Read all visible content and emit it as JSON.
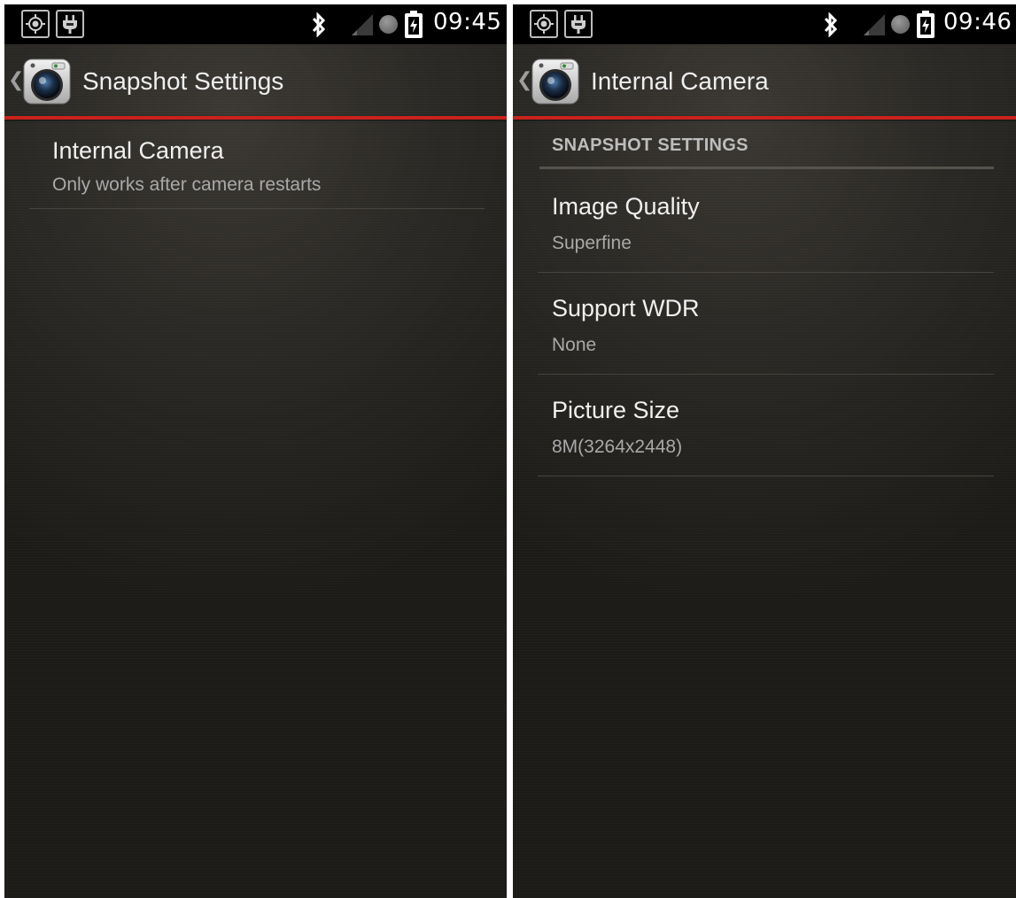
{
  "left_screen": {
    "status_bar": {
      "time": "09:45",
      "icons": [
        "gps-icon",
        "usb-debug-icon",
        "bluetooth-icon",
        "signal-icon",
        "sync-dot-icon",
        "battery-charging-icon"
      ]
    },
    "action_bar": {
      "title": "Snapshot Settings",
      "icon": "camera-app-icon",
      "back": "chevron-left-icon"
    },
    "preferences": [
      {
        "title": "Internal Camera",
        "summary": "Only works after camera restarts"
      }
    ]
  },
  "right_screen": {
    "status_bar": {
      "time": "09:46",
      "icons": [
        "gps-icon",
        "usb-debug-icon",
        "bluetooth-icon",
        "signal-icon",
        "sync-dot-icon",
        "battery-charging-icon"
      ]
    },
    "action_bar": {
      "title": "Internal Camera",
      "icon": "camera-app-icon",
      "back": "chevron-left-icon"
    },
    "category": "SNAPSHOT SETTINGS",
    "preferences": [
      {
        "title": "Image Quality",
        "summary": "Superfine"
      },
      {
        "title": "Support WDR",
        "summary": "None"
      },
      {
        "title": "Picture Size",
        "summary": "8M(3264x2448)"
      }
    ]
  },
  "colors": {
    "accent_underline": "#c8231d",
    "status_bar_bg": "#000000",
    "title_text": "#f0f0f0",
    "summary_text": "#a9a9a9"
  }
}
